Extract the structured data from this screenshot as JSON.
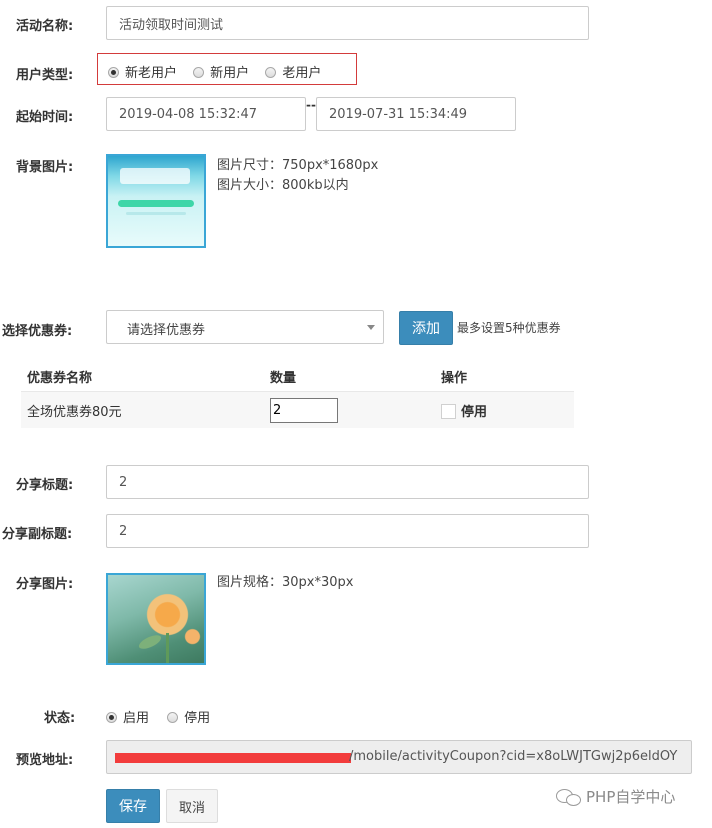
{
  "form": {
    "activity_name": {
      "label": "活动名称:",
      "value": "活动领取时间测试"
    },
    "user_type": {
      "label": "用户类型:",
      "options": [
        {
          "label": "新老用户",
          "checked": true
        },
        {
          "label": "新用户",
          "checked": false
        },
        {
          "label": "老用户",
          "checked": false
        }
      ],
      "highlight_color": "#d33b3b"
    },
    "time": {
      "label": "起始时间:",
      "start": "2019-04-08 15:32:47",
      "separator": "--",
      "end": "2019-07-31 15:34:49"
    },
    "background_image": {
      "label": "背景图片:",
      "size_hint": "图片尺寸：750px*1680px",
      "filesize_hint": "图片大小：800kb以内"
    },
    "coupon": {
      "label": "选择优惠券:",
      "placeholder": "请选择优惠券",
      "add_button": "添加",
      "limit_hint": "最多设置5种优惠券",
      "table": {
        "headers": [
          "优惠券名称",
          "数量",
          "操作"
        ],
        "rows": [
          {
            "name": "全场优惠券80元",
            "quantity": "2",
            "action_label": "停用"
          }
        ]
      }
    },
    "share_title": {
      "label": "分享标题:",
      "value": "2"
    },
    "share_subtitle": {
      "label": "分享副标题:",
      "value": "2"
    },
    "share_image": {
      "label": "分享图片:",
      "spec_hint": "图片规格：30px*30px"
    },
    "status": {
      "label": "状态:",
      "options": [
        {
          "label": "启用",
          "checked": true
        },
        {
          "label": "停用",
          "checked": false
        }
      ]
    },
    "preview": {
      "label": "预览地址:",
      "url": "/mobile/activityCoupon?cid=x8oLWJTGwj2p6eldOY",
      "redaction_color": "#f23c3c"
    },
    "buttons": {
      "save": "保存",
      "cancel": "取消"
    }
  },
  "watermark": {
    "text": "PHP自学中心"
  },
  "colors": {
    "primary": "#3c8dbc",
    "border": "#cccccc",
    "thumb_border": "#3aa6d6"
  }
}
